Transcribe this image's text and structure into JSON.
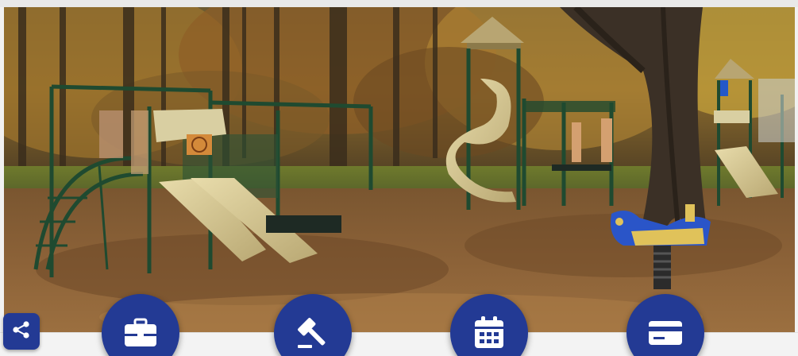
{
  "theme": {
    "button_color": "#233a94",
    "icon_color": "#ffffff",
    "bar_color": "#f3f3f3"
  },
  "hero": {
    "image_subject": "playground-photo"
  },
  "share": {
    "icon": "share-icon"
  },
  "actions": [
    {
      "icon": "briefcase-icon"
    },
    {
      "icon": "gavel-icon"
    },
    {
      "icon": "calendar-icon"
    },
    {
      "icon": "credit-card-icon"
    }
  ]
}
